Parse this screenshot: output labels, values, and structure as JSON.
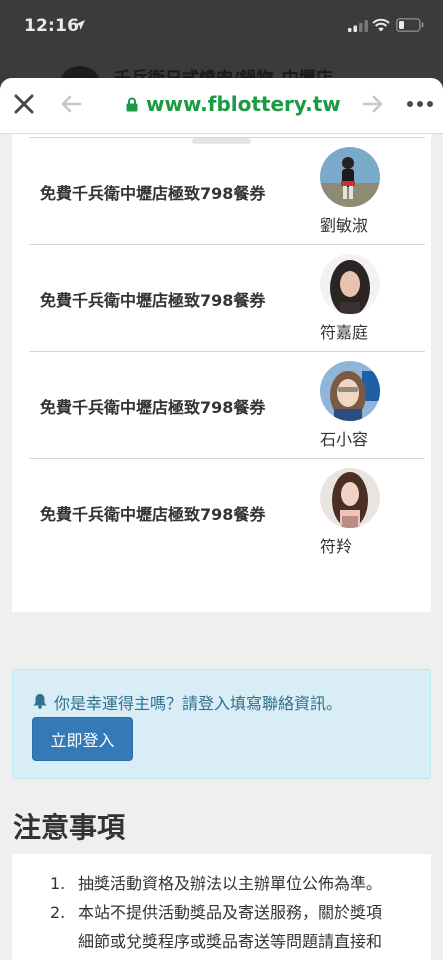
{
  "status_bar": {
    "time": "12:16",
    "icons": [
      "location-arrow-icon",
      "cellular-signal-icon",
      "wifi-icon",
      "battery-icon"
    ]
  },
  "behind_page": {
    "title": "千兵衛日式燒肉/鍋物_中壢店"
  },
  "browser": {
    "url": "www.fblottery.tw",
    "icons": [
      "close-icon",
      "back-arrow-icon",
      "lock-icon",
      "forward-arrow-icon",
      "more-icon"
    ]
  },
  "winners": [
    {
      "prize": "免費千兵衛中壢店極致798餐券",
      "name": "劉敏淑",
      "avatar_color": "#7aa9c9"
    },
    {
      "prize": "免費千兵衛中壢店極致798餐券",
      "name": "符嘉庭",
      "avatar_color": "#2a2522"
    },
    {
      "prize": "免費千兵衛中壢店極致798餐券",
      "name": "石小容",
      "avatar_color": "#8fb6d8"
    },
    {
      "prize": "免費千兵衛中壢店極致798餐券",
      "name": "符羚",
      "avatar_color": "#b98d86"
    }
  ],
  "alert": {
    "icon": "bell-icon",
    "text": "你是幸運得主嗎？請登入填寫聯絡資訊。",
    "button_label": "立即登入"
  },
  "notes": {
    "heading": "注意事項",
    "items": [
      {
        "num": "1.",
        "text": "抽獎活動資格及辦法以主辦單位公佈為準。"
      },
      {
        "num": "2.",
        "text": "本站不提供活動獎品及寄送服務，關於獎項",
        "cont": "細節或兌獎程序或獎品寄送等問題請直接和"
      }
    ]
  },
  "colors": {
    "url_green": "#1a9a43",
    "alert_bg": "#d9edf7",
    "alert_text": "#31708f",
    "button_blue": "#337ab7"
  }
}
